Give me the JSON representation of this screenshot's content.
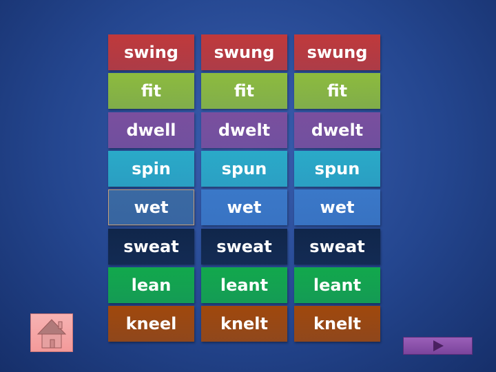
{
  "rows": [
    {
      "words": [
        "swing",
        "swung",
        "swung"
      ],
      "color": "#c0393b"
    },
    {
      "words": [
        "fit",
        "fit",
        "fit"
      ],
      "color": "#8dbb3e"
    },
    {
      "words": [
        "dwell",
        "dwelt",
        "dwelt"
      ],
      "color": "#7a4f9e"
    },
    {
      "words": [
        "spin",
        "spun",
        "spun"
      ],
      "color": "#2aaac8"
    },
    {
      "words": [
        "wet",
        "wet",
        "wet"
      ],
      "color": "#3a78c8",
      "first_color": "#3a69a2"
    },
    {
      "words": [
        "sweat",
        "sweat",
        "sweat"
      ],
      "color": "#10264a"
    },
    {
      "words": [
        "lean",
        "leant",
        "leant"
      ],
      "color": "#12a84c"
    },
    {
      "words": [
        "kneel",
        "knelt",
        "knelt"
      ],
      "color": "#a0480c"
    }
  ],
  "nav": {
    "home_icon": "house-icon",
    "next_icon": "play-triangle-icon"
  }
}
